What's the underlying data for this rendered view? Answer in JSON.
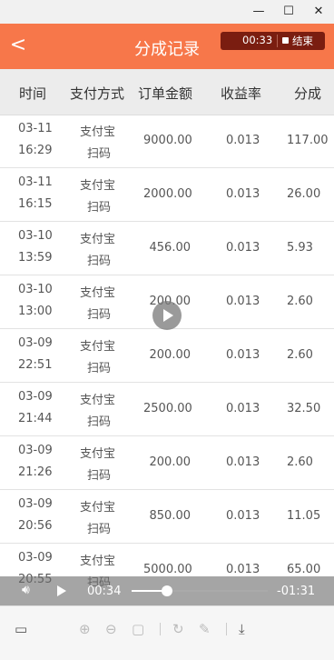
{
  "window": {
    "min_icon": "minimize-icon",
    "max_icon": "maximize-icon",
    "close_icon": "close-icon",
    "min": "—",
    "max": "☐",
    "close": "✕"
  },
  "header": {
    "back": "<",
    "title": "分成记录"
  },
  "recording": {
    "elapsed": "00:33",
    "end_label": "结束"
  },
  "table": {
    "columns": [
      "时间",
      "支付方式",
      "订单金额",
      "收益率",
      "分成"
    ],
    "rows": [
      {
        "date": "03-11",
        "time": "16:29",
        "pay1": "支付宝",
        "pay2": "扫码",
        "amount": "9000.00",
        "rate": "0.013",
        "share": "117.00"
      },
      {
        "date": "03-11",
        "time": "16:15",
        "pay1": "支付宝",
        "pay2": "扫码",
        "amount": "2000.00",
        "rate": "0.013",
        "share": "26.00"
      },
      {
        "date": "03-10",
        "time": "13:59",
        "pay1": "支付宝",
        "pay2": "扫码",
        "amount": "456.00",
        "rate": "0.013",
        "share": "5.93"
      },
      {
        "date": "03-10",
        "time": "13:00",
        "pay1": "支付宝",
        "pay2": "扫码",
        "amount": "200.00",
        "rate": "0.013",
        "share": "2.60"
      },
      {
        "date": "03-09",
        "time": "22:51",
        "pay1": "支付宝",
        "pay2": "扫码",
        "amount": "200.00",
        "rate": "0.013",
        "share": "2.60"
      },
      {
        "date": "03-09",
        "time": "21:44",
        "pay1": "支付宝",
        "pay2": "扫码",
        "amount": "2500.00",
        "rate": "0.013",
        "share": "32.50"
      },
      {
        "date": "03-09",
        "time": "21:26",
        "pay1": "支付宝",
        "pay2": "扫码",
        "amount": "200.00",
        "rate": "0.013",
        "share": "2.60"
      },
      {
        "date": "03-09",
        "time": "20:56",
        "pay1": "支付宝",
        "pay2": "扫码",
        "amount": "850.00",
        "rate": "0.013",
        "share": "11.05"
      },
      {
        "date": "03-09",
        "time": "20:55",
        "pay1": "支付宝",
        "pay2": "扫码",
        "amount": "5000.00",
        "rate": "0.013",
        "share": "65.00"
      },
      {
        "date": "03-09",
        "time": "",
        "pay1": "",
        "pay2": "",
        "amount": "",
        "rate": "",
        "share": ""
      }
    ]
  },
  "player": {
    "current": "00:34",
    "remaining": "-01:31",
    "progress": 0.26,
    "volume_icon": "speaker-icon",
    "play_icon": "play-icon"
  },
  "toolbar": {
    "icons": [
      "layout-icon",
      "zoom-in-icon",
      "zoom-out-icon",
      "actual-size-icon",
      "rotate-icon",
      "edit-icon",
      "download-icon"
    ],
    "glyphs": {
      "layout": "▭",
      "zoom_in": "⊕",
      "zoom_out": "⊖",
      "actual": "▢",
      "rotate": "↻",
      "edit": "✎",
      "download": "⤓"
    }
  }
}
